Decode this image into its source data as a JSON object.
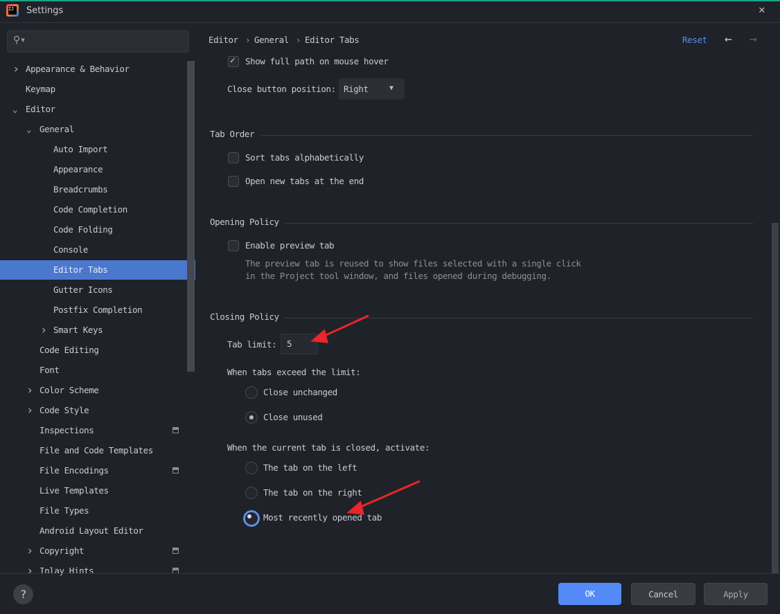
{
  "window": {
    "title": "Settings",
    "logo_text": "IJ",
    "accent": "#1aa38a"
  },
  "sidebar": {
    "search_placeholder": "",
    "items": [
      {
        "label": "Appearance & Behavior",
        "level": 0,
        "chevron": "right"
      },
      {
        "label": "Keymap",
        "level": 0
      },
      {
        "label": "Editor",
        "level": 0,
        "chevron": "down"
      },
      {
        "label": "General",
        "level": 1,
        "chevron": "down"
      },
      {
        "label": "Auto Import",
        "level": 2
      },
      {
        "label": "Appearance",
        "level": 2
      },
      {
        "label": "Breadcrumbs",
        "level": 2
      },
      {
        "label": "Code Completion",
        "level": 2
      },
      {
        "label": "Code Folding",
        "level": 2
      },
      {
        "label": "Console",
        "level": 2
      },
      {
        "label": "Editor Tabs",
        "level": 2,
        "selected": true
      },
      {
        "label": "Gutter Icons",
        "level": 2
      },
      {
        "label": "Postfix Completion",
        "level": 2
      },
      {
        "label": "Smart Keys",
        "level": 2,
        "chevron": "right"
      },
      {
        "label": "Code Editing",
        "level": 1
      },
      {
        "label": "Font",
        "level": 1
      },
      {
        "label": "Color Scheme",
        "level": 1,
        "chevron": "right"
      },
      {
        "label": "Code Style",
        "level": 1,
        "chevron": "right"
      },
      {
        "label": "Inspections",
        "level": 1,
        "badge": true
      },
      {
        "label": "File and Code Templates",
        "level": 1
      },
      {
        "label": "File Encodings",
        "level": 1,
        "badge": true
      },
      {
        "label": "Live Templates",
        "level": 1
      },
      {
        "label": "File Types",
        "level": 1
      },
      {
        "label": "Android Layout Editor",
        "level": 1
      },
      {
        "label": "Copyright",
        "level": 1,
        "chevron": "right",
        "badge": true
      },
      {
        "label": "Inlay Hints",
        "level": 1,
        "chevron": "right",
        "badge": true
      }
    ],
    "selected_color": "#4a78cf"
  },
  "header": {
    "breadcrumb": [
      "Editor",
      "General",
      "Editor Tabs"
    ],
    "separator": "›",
    "reset": "Reset"
  },
  "content": {
    "show_full_path": {
      "label": "Show full path on mouse hover",
      "checked": true
    },
    "close_button": {
      "label": "Close button position:",
      "value": "Right"
    },
    "tab_order": {
      "title": "Tab Order",
      "sort": {
        "label": "Sort tabs alphabetically",
        "checked": false
      },
      "open_end": {
        "label": "Open new tabs at the end",
        "checked": false
      }
    },
    "opening": {
      "title": "Opening Policy",
      "preview": {
        "label": "Enable preview tab",
        "checked": false
      },
      "hint1": "The preview tab is reused to show files selected with a single click",
      "hint2": "in the Project tool window, and files opened during debugging."
    },
    "closing": {
      "title": "Closing Policy",
      "tab_limit_label": "Tab limit:",
      "tab_limit": "5",
      "exceed_label": "When tabs exceed the limit:",
      "exceed_options": [
        {
          "label": "Close unchanged",
          "selected": false
        },
        {
          "label": "Close unused",
          "selected": true
        }
      ],
      "activate_label": "When the current tab is closed, activate:",
      "activate_options": [
        {
          "label": "The tab on the left",
          "selected": false
        },
        {
          "label": "The tab on the right",
          "selected": false
        },
        {
          "label": "Most recently opened tab",
          "selected": true
        }
      ]
    }
  },
  "footer": {
    "help": "?",
    "ok": "OK",
    "cancel": "Cancel",
    "apply": "Apply"
  },
  "annotation_color": "#e8262b"
}
